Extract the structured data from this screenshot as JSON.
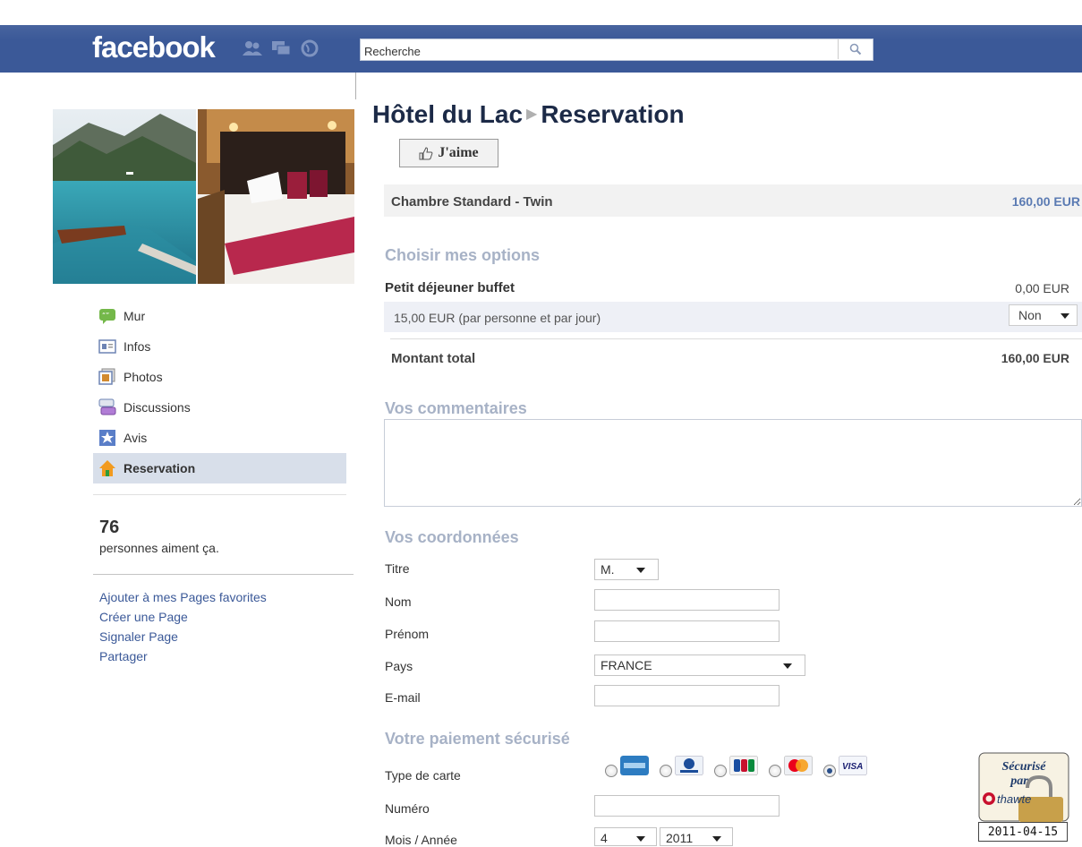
{
  "header": {
    "logo": "facebook",
    "search_placeholder": "Recherche"
  },
  "sidebar": {
    "items": [
      {
        "label": "Mur",
        "icon": "wall-icon"
      },
      {
        "label": "Infos",
        "icon": "info-icon"
      },
      {
        "label": "Photos",
        "icon": "photos-icon"
      },
      {
        "label": "Discussions",
        "icon": "discussions-icon"
      },
      {
        "label": "Avis",
        "icon": "reviews-icon"
      },
      {
        "label": "Reservation",
        "icon": "home-icon"
      }
    ],
    "likes_count": "76",
    "likes_text": "personnes aiment ça.",
    "links": [
      "Ajouter à mes Pages favorites",
      "Créer une Page",
      "Signaler Page",
      "Partager"
    ]
  },
  "main": {
    "page_name": "Hôtel du Lac",
    "page_section": "Reservation",
    "like_button": "J'aime",
    "room": {
      "name": "Chambre Standard - Twin",
      "price": "160,00 EUR"
    },
    "options": {
      "title": "Choisir mes options",
      "item_name": "Petit déjeuner buffet",
      "item_price": "0,00 EUR",
      "item_desc": "15,00 EUR (par personne et par jour)",
      "item_choice": "Non"
    },
    "total": {
      "label": "Montant total",
      "value": "160,00 EUR"
    },
    "comments_title": "Vos commentaires",
    "contact": {
      "title": "Vos coordonnées",
      "titre_label": "Titre",
      "titre_value": "M.",
      "nom_label": "Nom",
      "prenom_label": "Prénom",
      "pays_label": "Pays",
      "pays_value": "FRANCE",
      "email_label": "E-mail"
    },
    "payment": {
      "title": "Votre paiement sécurisé",
      "card_type_label": "Type de carte",
      "number_label": "Numéro",
      "month_year_label": "Mois / Année",
      "month_value": "4",
      "year_value": "2011",
      "cards": [
        "amex",
        "diners",
        "jcb",
        "mastercard",
        "VISA"
      ],
      "selected_card": "VISA",
      "badge_line1": "Sécurisé",
      "badge_line2": "par",
      "badge_brand": "thawte",
      "badge_date": "2011-04-15"
    }
  }
}
